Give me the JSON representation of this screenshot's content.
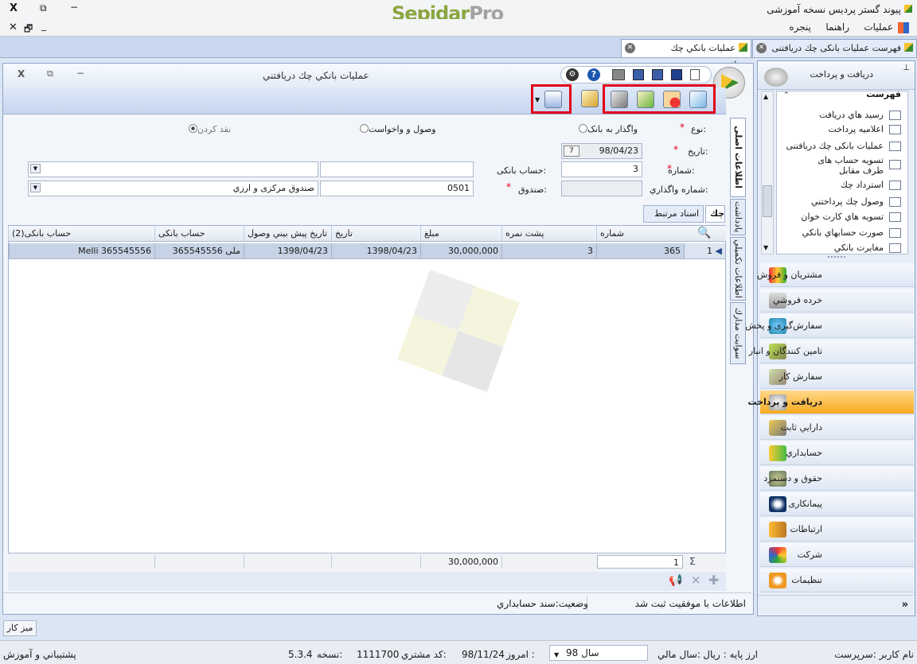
{
  "app": {
    "title": "پیوند گستر پردیس نسخه آموزشی",
    "logo_a": "Sepidar",
    "logo_b": "Pro",
    "close": "X",
    "restore": "⧉",
    "minimize": "−"
  },
  "menu": {
    "operations": "عملیات",
    "help": "راهنما",
    "window": "پنجره",
    "mdi_close": "✕",
    "mdi_restore": "🗗",
    "mdi_min": "_"
  },
  "tabs": [
    {
      "label": "فهرست عملیات بانکی چك دریافتنی"
    },
    {
      "label": "عملیات بانكي چك دريافتني"
    }
  ],
  "window": {
    "title": "عملیات بانكي چك دريافتني",
    "close": "X",
    "restore": "⧉",
    "min": "−"
  },
  "form": {
    "type_label": "نوع:",
    "radio_bank": "واگذار به بانک",
    "radio_collect": "وصول و واخواست",
    "radio_cash": "نقد کردن",
    "date_label": "تاریخ:",
    "date_value": "98/04/23",
    "number_label": "شماره:",
    "number_value": "3",
    "bank_account_label": "حساب بانکی:",
    "bank_account_value": "",
    "assign_number_label": "شماره واگذاري:",
    "assign_number_value": "",
    "fund_label": "صندوق:",
    "fund_code": "0501",
    "fund_name": "صندوق مرکزی و ارزي"
  },
  "side_tabs": {
    "main": "اطلاعات اصلی",
    "notes": "یادداشت",
    "extra": "اطلاعات تكميلي",
    "docs": "سوابت مدارك"
  },
  "subtabs": {
    "cheque": "چك",
    "related": "اسناد مرتبط"
  },
  "grid": {
    "columns": [
      "شماره",
      "پشت نمره",
      "مبلغ",
      "تاریخ",
      "تاريخ پيش بيني وصول",
      "حساب بانکی",
      "حساب بانکی(2)"
    ],
    "rows": [
      {
        "idx": "1",
        "number": "365",
        "back": "3",
        "amount": "30,000,000",
        "date": "1398/04/23",
        "forecast": "1398/04/23",
        "account": "ملی 365545556",
        "account2": "Melli 365545556"
      }
    ],
    "footer": {
      "count": "1",
      "sum": "30,000,000"
    }
  },
  "status": {
    "message": "اطلاعات با موفقیت ثبت شد",
    "state": "وضعيت:سند حسابداري"
  },
  "nav": {
    "header": "دریافت و پرداخت",
    "tree_header": "فهرست",
    "tree": [
      "رسيد هاي دريافت",
      "اعلاميه پرداخت",
      "عملیات بانکی چك دریافتنی",
      "تسویه حساب های طرف مقابل",
      "استرداد چك",
      "وصول چك پرداختني",
      "تسويه هاي كارت خوان",
      "صورت حسابهاي بانكي",
      "مغايرت بانكي"
    ],
    "modules": [
      "مشتریان و فروش",
      "خرده فروشي",
      "سفارش‌گیری و پخش",
      "تامین کنندگان و انبار",
      "سفارش کار",
      "دریافت و پرداخت",
      "دارايي ثابت",
      "حسابداري",
      "حقوق و دستمزد",
      "پیمانکاری",
      "ارتباطات",
      "شرکت",
      "تنظیمات"
    ],
    "expand": "»"
  },
  "desktop_tab": "ميز كار",
  "footer": {
    "user": "نام کاربر :سرپرست",
    "currency": "ارز پایه : ریال",
    "fiscal_year_label": "سال مالي:",
    "fiscal_year": "سال 98",
    "today_label": "امروز :",
    "today": "98/11/24",
    "customer_code_label": "کد مشتري:",
    "customer_code": "1111700",
    "version_label": "نسخه:",
    "version": "5.3.4",
    "support": "پشتيباني و آموزش"
  },
  "colors": {
    "accent": "#f6a91f",
    "red_highlight": "#e0001b",
    "selected_row": "#c6d2e5",
    "logo_green": "#8aa642"
  }
}
